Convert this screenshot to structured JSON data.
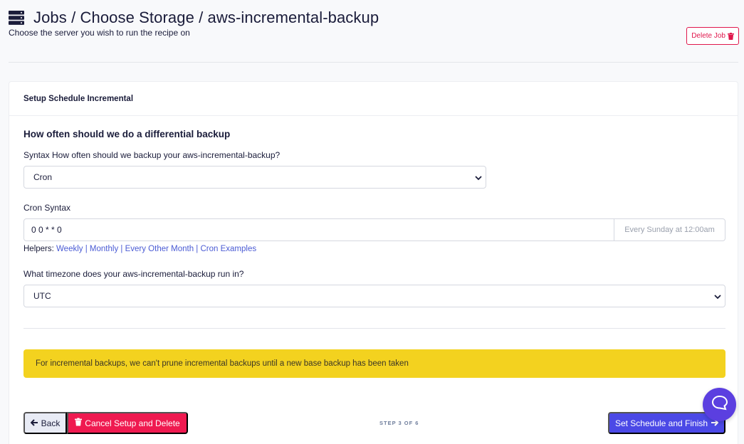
{
  "header": {
    "title": "Jobs / Choose Storage / aws-incremental-backup",
    "subtitle": "Choose the server you wish to run the recipe on",
    "delete_job_label": "Delete Job"
  },
  "card": {
    "header_title": "Setup Schedule Incremental",
    "section_title": "How often should we do a differential backup",
    "syntax_label": "Syntax How often should we backup your aws-incremental-backup?",
    "syntax_select_value": "Cron",
    "cron_label": "Cron Syntax",
    "cron_value": "0 0 * * 0",
    "cron_description": "Every Sunday at 12:00am",
    "helpers": {
      "prefix": "Helpers:",
      "links": [
        "Weekly",
        "Monthly",
        "Every Other Month",
        "Cron Examples"
      ],
      "separator": " | "
    },
    "timezone_label": "What timezone does your aws-incremental-backup run in?",
    "timezone_value": "UTC",
    "alert_text": "For incremental backups, we can't prune incremental backups until a new base backup has been taken"
  },
  "footer": {
    "back_label": "Back",
    "cancel_label": "Cancel Setup and Delete",
    "step_text": "STEP 3 OF 6",
    "finish_label": "Set Schedule and Finish"
  },
  "colors": {
    "danger": "#ef1a50",
    "primary": "#4b49e6",
    "warning": "#f3d21f",
    "link": "#4a5bd4",
    "chat": "#5b3fe0"
  },
  "icons": [
    "server-icon",
    "trash-icon",
    "chevron-down-icon",
    "arrow-left-icon",
    "arrow-right-icon",
    "chat-icon"
  ]
}
